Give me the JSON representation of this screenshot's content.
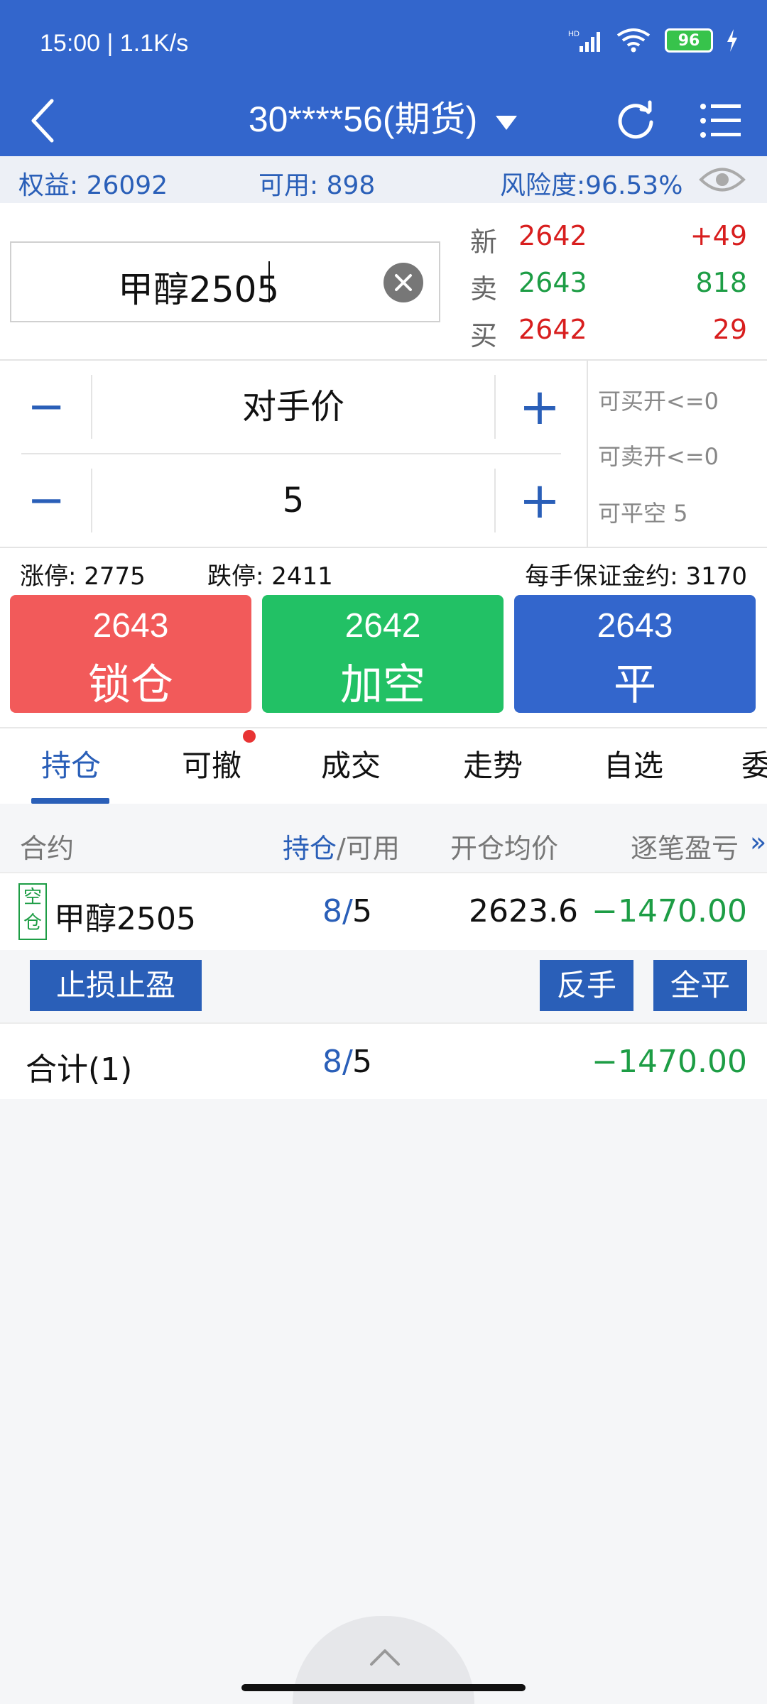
{
  "status_bar": {
    "time": "15:00 | 1.1K/s",
    "battery": "96"
  },
  "nav": {
    "title": "30****56(期货)"
  },
  "summary": {
    "equity": "权益: 26092",
    "available": "可用: 898",
    "risk": "风险度:96.53%"
  },
  "symbol": {
    "name": "甲醇2505"
  },
  "quotes": [
    {
      "label": "新",
      "price": "2642",
      "vol": "+49",
      "price_color": "#d81e1e",
      "vol_color": "#d81e1e"
    },
    {
      "label": "卖",
      "price": "2643",
      "vol": "818",
      "price_color": "#1d9d45",
      "vol_color": "#1d9d45"
    },
    {
      "label": "买",
      "price": "2642",
      "vol": "29",
      "price_color": "#d81e1e",
      "vol_color": "#d81e1e"
    }
  ],
  "controls": {
    "minus": "−",
    "plus": "+",
    "price_type": "对手价",
    "quantity": "5"
  },
  "available_info": {
    "buy_open": "可买开<=0",
    "sell_open": "可卖开<=0",
    "close_short": "可平空 5"
  },
  "limits": {
    "up": "涨停: 2775",
    "down": "跌停: 2411",
    "margin": "每手保证金约: 3170"
  },
  "trade_buttons": [
    {
      "price": "2643",
      "action": "锁仓",
      "color": "#f25a5a"
    },
    {
      "price": "2642",
      "action": "加空",
      "color": "#22c165"
    },
    {
      "price": "2643",
      "action": "平",
      "color": "#3366cc"
    }
  ],
  "tabs": [
    "持仓",
    "可撤",
    "成交",
    "走势",
    "自选",
    "委"
  ],
  "table": {
    "headers": {
      "contract": "合约",
      "holding": "持仓",
      "slash": "/",
      "available": "可用",
      "avg_price": "开仓均价",
      "pnl": "逐笔盈亏",
      "more": "»"
    },
    "position": {
      "tag": "空仓",
      "name": "甲醇2505",
      "holding": "8/",
      "available": "5",
      "avg_price": "2623.6",
      "pnl": "−1470.00"
    },
    "actions": {
      "stop": "止损止盈",
      "reverse": "反手",
      "close_all": "全平"
    },
    "total": {
      "label": "合计(1)",
      "holding": "8/",
      "available": "5",
      "pnl": "−1470.00"
    }
  },
  "colors": {
    "brand": "#3366cc",
    "up": "#d81e1e",
    "down": "#1d9d45"
  }
}
